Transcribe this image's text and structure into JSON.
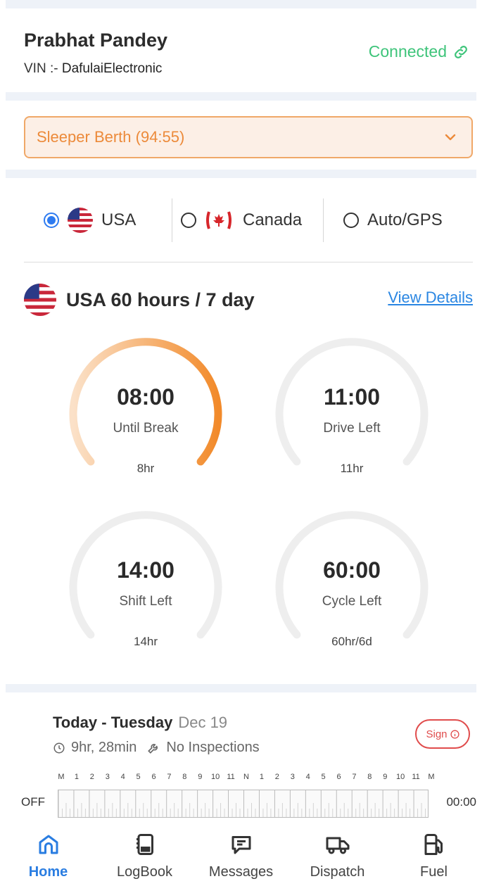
{
  "driver": {
    "name": "Prabhat Pandey",
    "vin_label": "VIN :-",
    "vin_value": "DafulaiElectronic"
  },
  "connection": {
    "status": "Connected",
    "icon": "link-icon",
    "color": "#3ec47a"
  },
  "duty_status": {
    "selected": "Sleeper Berth  (94:55)",
    "icon": "chevron-down-icon"
  },
  "regions": [
    {
      "label": "USA",
      "icon": "us-flag-icon",
      "selected": true
    },
    {
      "label": "Canada",
      "icon": "canada-flag-icon",
      "selected": false
    },
    {
      "label": "Auto/GPS",
      "selected": false
    }
  ],
  "rule": {
    "title": "USA 60 hours / 7 day",
    "link": "View Details"
  },
  "gauges": [
    {
      "time": "08:00",
      "label": "Until Break",
      "limit": "8hr",
      "progress": 1.0,
      "active": true
    },
    {
      "time": "11:00",
      "label": "Drive Left",
      "limit": "11hr",
      "progress": 0,
      "active": false
    },
    {
      "time": "14:00",
      "label": "Shift Left",
      "limit": "14hr",
      "progress": 0,
      "active": false
    },
    {
      "time": "60:00",
      "label": "Cycle Left",
      "limit": "60hr/6d",
      "progress": 0,
      "active": false
    }
  ],
  "log": {
    "day": "Today - Tuesday",
    "date": "Dec 19",
    "duration": "9hr, 28min",
    "inspections": "No Inspections",
    "sign_label": "Sign",
    "hours": [
      "M",
      "1",
      "2",
      "3",
      "4",
      "5",
      "6",
      "7",
      "8",
      "9",
      "10",
      "11",
      "N",
      "1",
      "2",
      "3",
      "4",
      "5",
      "6",
      "7",
      "8",
      "9",
      "10",
      "11",
      "M"
    ],
    "row_label": "OFF",
    "row_total": "00:00"
  },
  "tabs": [
    {
      "label": "Home",
      "icon": "home-icon",
      "active": true
    },
    {
      "label": "LogBook",
      "icon": "logbook-icon",
      "active": false
    },
    {
      "label": "Messages",
      "icon": "message-icon",
      "active": false
    },
    {
      "label": "Dispatch",
      "icon": "truck-icon",
      "active": false
    },
    {
      "label": "Fuel",
      "icon": "fuel-pump-icon",
      "active": false
    }
  ],
  "colors": {
    "accent": "#2a7de1",
    "warning": "#ec8a3a",
    "danger": "#e04c4c"
  }
}
